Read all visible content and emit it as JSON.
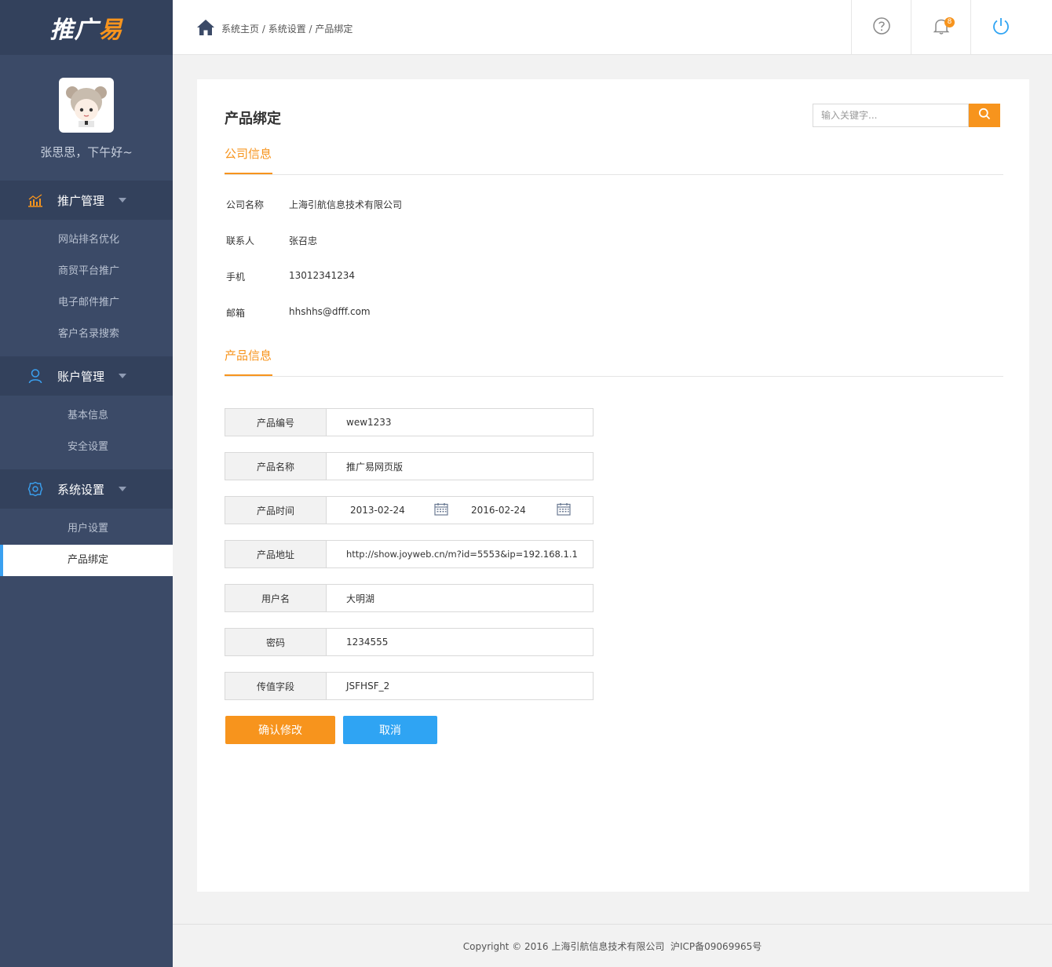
{
  "brand": {
    "logo_main": "推广",
    "logo_accent": "易"
  },
  "profile": {
    "greeting": "张思思，下午好~"
  },
  "sidebar": {
    "groups": [
      {
        "label": "推广管理",
        "icon": "chart-icon",
        "items": [
          "网站排名优化",
          "商贸平台推广",
          "电子邮件推广",
          "客户名录搜索"
        ]
      },
      {
        "label": "账户管理",
        "icon": "user-icon",
        "items": [
          "基本信息",
          "安全设置"
        ]
      },
      {
        "label": "系统设置",
        "icon": "gear-icon",
        "items": [
          "用户设置",
          "产品绑定"
        ],
        "active": "产品绑定"
      }
    ]
  },
  "header": {
    "breadcrumb": [
      "系统主页",
      "系统设置",
      "产品绑定"
    ],
    "breadcrumb_separator": " / ",
    "notification_count": "8",
    "icons": [
      "help-icon",
      "bell-icon",
      "power-icon"
    ]
  },
  "page": {
    "title": "产品绑定",
    "search_placeholder": "输入关键字..."
  },
  "company": {
    "section_title": "公司信息",
    "rows": [
      {
        "label": "公司名称",
        "value": "上海引航信息技术有限公司"
      },
      {
        "label": "联系人",
        "value": "张召忠"
      },
      {
        "label": "手机",
        "value": "13012341234"
      },
      {
        "label": "邮箱",
        "value": "hhshhs@dfff.com"
      }
    ]
  },
  "product": {
    "section_title": "产品信息",
    "fields": {
      "code": {
        "label": "产品编号",
        "value": "wew1233"
      },
      "name": {
        "label": "产品名称",
        "value": "推广易网页版"
      },
      "time": {
        "label": "产品时间",
        "start": "2013-02-24",
        "end": "2016-02-24"
      },
      "address": {
        "label": "产品地址",
        "value": "http://show.joyweb.cn/m?id=5553&ip=192.168.1.1"
      },
      "username": {
        "label": "用户名",
        "value": "大明湖"
      },
      "password": {
        "label": "密码",
        "value": "1234555"
      },
      "param": {
        "label": "传值字段",
        "value": "JSFHSF_2"
      }
    },
    "confirm_label": "确认修改",
    "cancel_label": "取消"
  },
  "footer": {
    "text": "Copyright © 2016 上海引航信息技术有限公司  沪ICP备09069965号"
  },
  "colors": {
    "accent": "#f7941d",
    "primary_blue": "#2fa4f3",
    "sidebar": "#3b4a67",
    "sidebar_dark": "#33415c"
  }
}
